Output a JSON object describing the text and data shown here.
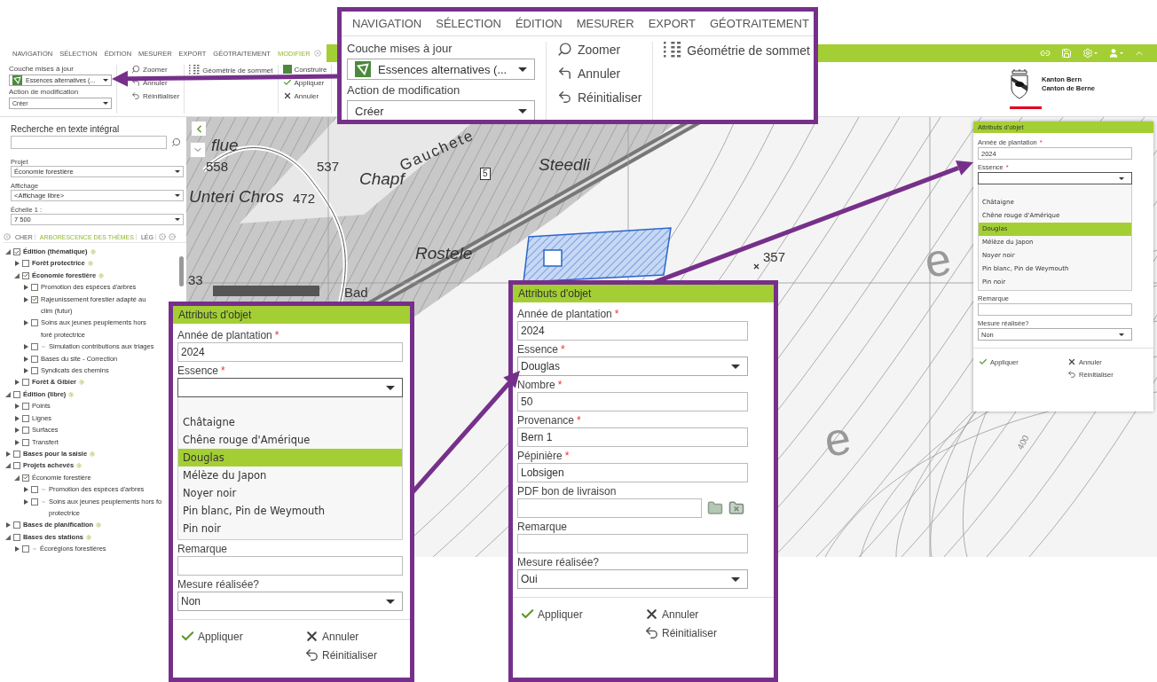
{
  "ribbon": {
    "tabs": [
      {
        "label": "NAVIGATION",
        "selected": false
      },
      {
        "label": "SÉLECTION",
        "selected": false
      },
      {
        "label": "ÉDITION",
        "selected": false
      },
      {
        "label": "MESURER",
        "selected": false
      },
      {
        "label": "EXPORT",
        "selected": false
      },
      {
        "label": "GÉOTRAITEMENT",
        "selected": false
      },
      {
        "label": "MODIFIER",
        "selected": true
      }
    ],
    "layer_label": "Couche mises à jour",
    "layer_value": "Essences alternatives (...",
    "action_label": "Action de modification",
    "action_value": "Créer",
    "tools": [
      {
        "kind": "zoom",
        "label": "Zoomer"
      },
      {
        "kind": "undo",
        "label": "Annuler"
      },
      {
        "kind": "reset",
        "label": "Réinitialiser"
      }
    ],
    "vertex_tool": "Géométrie de sommet",
    "edit_tools": [
      {
        "kind": "build",
        "label": "Construire"
      },
      {
        "kind": "apply",
        "label": "Appliquer"
      },
      {
        "kind": "cancel",
        "label": "Annuler"
      }
    ]
  },
  "brand": {
    "line1": "Kanton Bern",
    "line2": "Canton de Berne"
  },
  "sidebar": {
    "search_label": "Recherche en texte intégral",
    "fields": [
      {
        "label": "Projet",
        "value": "Économie forestière"
      },
      {
        "label": "Affichage",
        "value": "<Affichage libre>"
      },
      {
        "label": "Échelle 1 :",
        "value": "7 500"
      }
    ],
    "tabs": [
      {
        "label": "CHER",
        "selected": false
      },
      {
        "label": "ARBORESCENCE DES THÈMES",
        "selected": true
      },
      {
        "label": "LÉG",
        "selected": false
      }
    ],
    "tree": [
      {
        "label": "Édition (thématique)",
        "kind": "group",
        "checked": true,
        "expanded": true,
        "filter": false,
        "children": [
          {
            "label": "Forêt protectrice",
            "kind": "group",
            "checked": false,
            "expanded": false,
            "filter": false
          },
          {
            "label": "Économie forestière",
            "kind": "group",
            "checked": true,
            "expanded": true,
            "filter": false,
            "children": [
              {
                "label": "Promotion des espèces d'arbres",
                "kind": "layer",
                "checked": false,
                "expanded": false,
                "filter": false
              },
              {
                "label": "Rajeunissement forestier adapté au clim (futur)",
                "kind": "layer",
                "checked": true,
                "expanded": false,
                "filter": false
              },
              {
                "label": "Soins aux jeunes peuplements hors forê protectrice",
                "kind": "layer",
                "checked": false,
                "expanded": false,
                "filter": false
              },
              {
                "label": "Simulation contributions aux triages",
                "kind": "layer",
                "checked": false,
                "expanded": false,
                "filter": true
              },
              {
                "label": "Bases du site - Correction",
                "kind": "layer",
                "checked": false,
                "expanded": false,
                "filter": false
              },
              {
                "label": "Syndicats des chemins",
                "kind": "layer",
                "checked": false,
                "expanded": false,
                "filter": false
              }
            ]
          },
          {
            "label": "Forêt & Gibier",
            "kind": "group",
            "checked": false,
            "expanded": false,
            "filter": false
          }
        ]
      },
      {
        "label": "Édition (libre)",
        "kind": "group",
        "checked": false,
        "expanded": true,
        "filter": false,
        "children": [
          {
            "label": "Points",
            "kind": "layer",
            "checked": false,
            "expanded": false,
            "filter": false
          },
          {
            "label": "Lignes",
            "kind": "layer",
            "checked": false,
            "expanded": false,
            "filter": false
          },
          {
            "label": "Surfaces",
            "kind": "layer",
            "checked": false,
            "expanded": false,
            "filter": false
          },
          {
            "label": "Transfert",
            "kind": "layer",
            "checked": false,
            "expanded": false,
            "filter": false
          }
        ]
      },
      {
        "label": "Bases pour la saisie",
        "kind": "group",
        "checked": false,
        "expanded": false,
        "filter": false
      },
      {
        "label": "Projets achevés",
        "kind": "group",
        "checked": false,
        "expanded": true,
        "filter": false,
        "children": [
          {
            "label": "Économie forestière",
            "kind": "layer",
            "checked": true,
            "expanded": true,
            "filter": false,
            "children": [
              {
                "label": "Promotion des espèces d'arbres",
                "kind": "layer",
                "checked": false,
                "expanded": false,
                "filter": true
              },
              {
                "label": "Soins aux jeunes peuplements hors fo protectrice",
                "kind": "layer",
                "checked": false,
                "expanded": false,
                "filter": true
              }
            ]
          }
        ]
      },
      {
        "label": "Bases de planification",
        "kind": "group",
        "checked": false,
        "expanded": false,
        "filter": false
      },
      {
        "label": "Bases des stations",
        "kind": "group",
        "checked": false,
        "expanded": true,
        "filter": false,
        "children": [
          {
            "label": "Écorégions forestières",
            "kind": "layer",
            "checked": false,
            "expanded": false,
            "filter": true
          }
        ]
      }
    ]
  },
  "map": {
    "labels": [
      {
        "text": "flue",
        "kind": "place"
      },
      {
        "text": "558",
        "kind": "number"
      },
      {
        "text": "537",
        "kind": "number"
      },
      {
        "text": "Unteri Chros",
        "kind": "place"
      },
      {
        "text": "472",
        "kind": "number"
      },
      {
        "text": "Chapf",
        "kind": "place"
      },
      {
        "text": "Gauchete",
        "kind": "locality"
      },
      {
        "text": "5",
        "kind": "road"
      },
      {
        "text": "Steedli",
        "kind": "place"
      },
      {
        "text": "Rostele",
        "kind": "place"
      },
      {
        "text": "357",
        "kind": "number"
      },
      {
        "text": "33",
        "kind": "number"
      },
      {
        "text": "Bad",
        "kind": "number"
      },
      {
        "text": "e",
        "kind": "terrain"
      },
      {
        "text": "e",
        "kind": "terrain"
      },
      {
        "text": "400",
        "kind": "elevation"
      }
    ]
  },
  "attribute_panel": {
    "title": "Attributs d'objet",
    "fields": [
      {
        "kind": "text",
        "label": "Année de plantation",
        "mark": "*",
        "value": "2024"
      },
      {
        "kind": "select",
        "label": "Essence",
        "mark": "*",
        "open": true,
        "options": [
          {
            "label": "Châtaigne",
            "selected": false
          },
          {
            "label": "Chêne rouge d'Amérique",
            "selected": false
          },
          {
            "label": "Douglas",
            "selected": true
          },
          {
            "label": "Mélèze du Japon",
            "selected": false
          },
          {
            "label": "Noyer noir",
            "selected": false
          },
          {
            "label": "Pin blanc, Pin de Weymouth",
            "selected": false
          },
          {
            "label": "Pin noir",
            "selected": false
          }
        ]
      },
      {
        "kind": "text",
        "label": "Remarque"
      },
      {
        "kind": "select",
        "label": "Mesure réalisée?",
        "value": "Non",
        "open": false
      }
    ],
    "actions": [
      {
        "kind": "apply",
        "label": "Appliquer"
      },
      {
        "kind": "cancel",
        "label": "Annuler"
      },
      {
        "kind": "reset",
        "label": "Réinitialiser"
      }
    ]
  },
  "callout_ribbon": {
    "tabs": [
      {
        "label": "NAVIGATION",
        "selected": false
      },
      {
        "label": "SÉLECTION",
        "selected": false
      },
      {
        "label": "ÉDITION",
        "selected": false
      },
      {
        "label": "MESURER",
        "selected": false
      },
      {
        "label": "EXPORT",
        "selected": false
      },
      {
        "label": "GÉOTRAITEMENT",
        "selected": false
      }
    ],
    "layer_label": "Couche mises à jour",
    "layer_value": "Essences alternatives (...",
    "action_label": "Action de modification",
    "action_value": "Créer",
    "tools": [
      {
        "kind": "zoom",
        "label": "Zoomer"
      },
      {
        "kind": "undo",
        "label": "Annuler"
      },
      {
        "kind": "reset",
        "label": "Réinitialiser"
      }
    ],
    "vertex_tool": "Géométrie de sommet"
  },
  "callout_form_open": {
    "title": "Attributs d'objet",
    "fields": [
      {
        "kind": "text",
        "label": "Année de plantation",
        "mark": "*",
        "value": "2024"
      },
      {
        "kind": "select",
        "label": "Essence",
        "mark": "*",
        "open": true,
        "options": [
          {
            "label": "Châtaigne",
            "selected": false
          },
          {
            "label": "Chêne rouge d'Amérique",
            "selected": false
          },
          {
            "label": "Douglas",
            "selected": true
          },
          {
            "label": "Mélèze du Japon",
            "selected": false
          },
          {
            "label": "Noyer noir",
            "selected": false
          },
          {
            "label": "Pin blanc, Pin de Weymouth",
            "selected": false
          },
          {
            "label": "Pin noir",
            "selected": false
          }
        ]
      },
      {
        "kind": "text",
        "label": "Remarque"
      },
      {
        "kind": "select",
        "label": "Mesure réalisée?",
        "value": "Non",
        "open": false
      }
    ],
    "actions": [
      {
        "kind": "apply",
        "label": "Appliquer"
      },
      {
        "kind": "cancel",
        "label": "Annuler"
      },
      {
        "kind": "reset",
        "label": "Réinitialiser"
      }
    ]
  },
  "callout_form_filled": {
    "title": "Attributs d'objet",
    "fields": [
      {
        "kind": "text",
        "label": "Année de plantation",
        "mark": "*",
        "value": "2024"
      },
      {
        "kind": "select",
        "label": "Essence",
        "mark": "*",
        "value": "Douglas",
        "open": false
      },
      {
        "kind": "text",
        "label": "Nombre",
        "mark": "*",
        "value": "50"
      },
      {
        "kind": "text",
        "label": "Provenance",
        "mark": "*",
        "value": "Bern 1"
      },
      {
        "kind": "text",
        "label": "Pépinière",
        "mark": "*",
        "value": "Lobsigen"
      },
      {
        "kind": "file",
        "label": "PDF bon de livraison"
      },
      {
        "kind": "text",
        "label": "Remarque"
      },
      {
        "kind": "select",
        "label": "Mesure réalisée?",
        "value": "Oui",
        "open": false
      }
    ],
    "actions": [
      {
        "kind": "apply",
        "label": "Appliquer"
      },
      {
        "kind": "cancel",
        "label": "Annuler"
      },
      {
        "kind": "reset",
        "label": "Réinitialiser"
      }
    ]
  }
}
